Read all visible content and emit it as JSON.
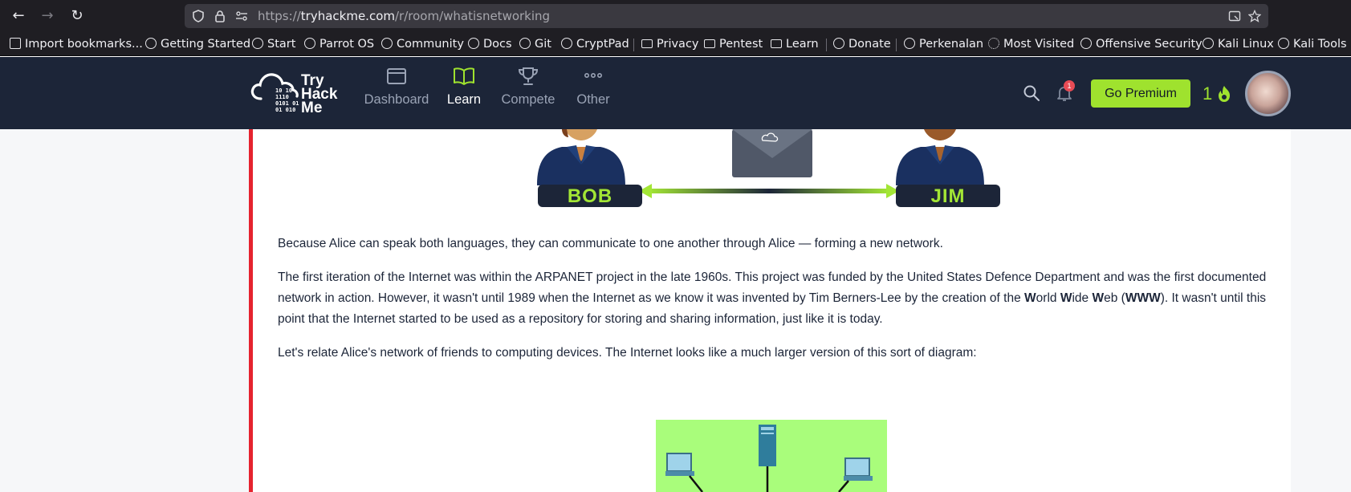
{
  "browser": {
    "url_prefix": "https://",
    "url_host": "tryhackme.com",
    "url_path": "/r/room/whatisnetworking",
    "bookmarks": [
      {
        "label": "Import bookmarks...",
        "icon": "import-icon"
      },
      {
        "label": "Getting Started",
        "icon": "globe-icon"
      },
      {
        "label": "Start",
        "icon": "globe-icon"
      },
      {
        "label": "Parrot OS",
        "icon": "globe-icon"
      },
      {
        "label": "Community",
        "icon": "globe-icon"
      },
      {
        "label": "Docs",
        "icon": "globe-icon"
      },
      {
        "label": "Git",
        "icon": "globe-icon"
      },
      {
        "label": "CryptPad",
        "icon": "globe-icon"
      },
      {
        "label": "Privacy",
        "icon": "folder-icon"
      },
      {
        "label": "Pentest",
        "icon": "folder-icon"
      },
      {
        "label": "Learn",
        "icon": "folder-icon"
      },
      {
        "label": "Donate",
        "icon": "globe-icon"
      },
      {
        "label": "Perkenalan",
        "icon": "globe-icon"
      },
      {
        "label": "Most Visited",
        "icon": "gear-icon"
      },
      {
        "label": "Offensive Security",
        "icon": "globe-icon"
      },
      {
        "label": "Kali Linux",
        "icon": "globe-icon"
      },
      {
        "label": "Kali Tools",
        "icon": "globe-icon"
      }
    ]
  },
  "header": {
    "logo_bits": "10 10\n1110\n0101 01\n01 010",
    "logo_line1": "Try",
    "logo_line2": "Hack",
    "logo_line3": "Me",
    "nav": [
      {
        "label": "Dashboard",
        "icon": "dashboard-icon",
        "active": false
      },
      {
        "label": "Learn",
        "icon": "book-icon",
        "active": true
      },
      {
        "label": "Compete",
        "icon": "trophy-icon",
        "active": false
      },
      {
        "label": "Other",
        "icon": "more-icon",
        "active": false
      }
    ],
    "notification_count": "1",
    "premium_label": "Go Premium",
    "streak": "1",
    "accent": "#9fe22e",
    "bg": "#1c2538"
  },
  "content": {
    "illustration_top": {
      "left_person": "BOB",
      "right_person": "JIM"
    },
    "paragraph1": "Because Alice can speak both languages, they can communicate to one another through Alice — forming a new network.",
    "paragraph2": {
      "part1": "The first iteration of the Internet was within the ARPANET project in the late 1960s. This project was funded by the United States Defence Department and was the first documented network in action. However, it wasn't until 1989 when the Internet as we know it was invented by Tim Berners-Lee by the creation of the ",
      "w1": "W",
      "orld": "orld ",
      "w2": "W",
      "ide": "ide ",
      "w3": "W",
      "eb": "eb (",
      "www": "WWW",
      "part2": "). It wasn't until this point that the Internet started to be used as a repository for storing and sharing information, just like it is today."
    },
    "paragraph3": "Let's relate Alice's network of friends to computing devices. The Internet looks like a much larger version of this sort of diagram:"
  }
}
